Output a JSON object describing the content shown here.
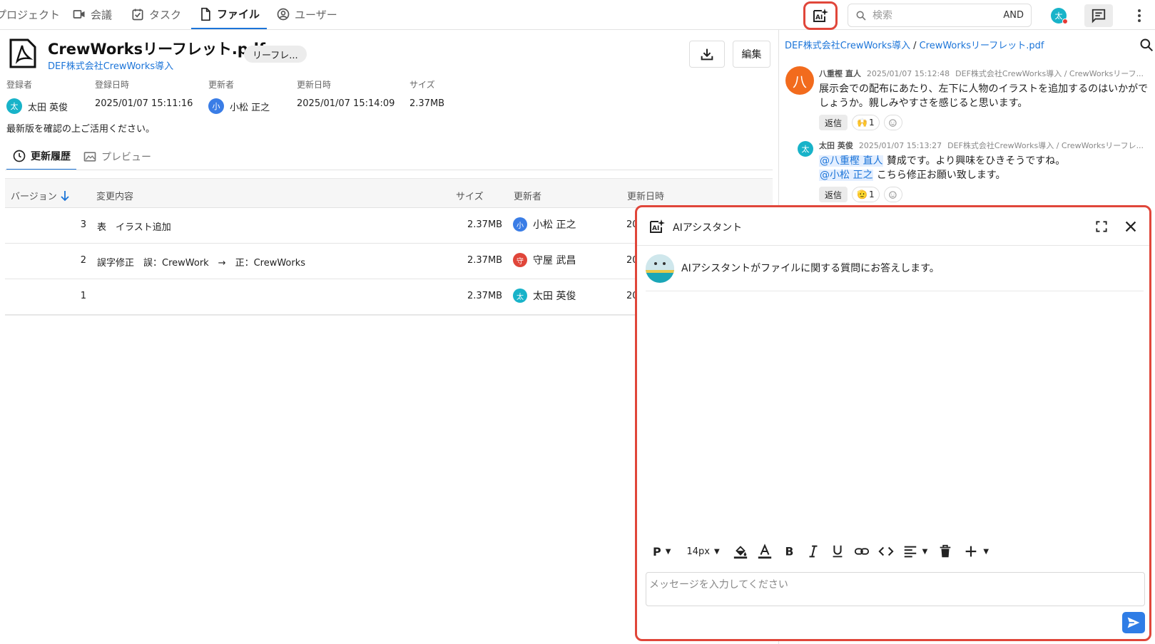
{
  "nav": {
    "tabs": [
      {
        "label": "プロジェクト",
        "icon": "project-icon"
      },
      {
        "label": "会議",
        "icon": "video-icon"
      },
      {
        "label": "タスク",
        "icon": "task-icon"
      },
      {
        "label": "ファイル",
        "icon": "file-icon",
        "active": true
      },
      {
        "label": "ユーザー",
        "icon": "user-circle-icon"
      }
    ],
    "search_placeholder": "検索",
    "search_mode": "AND",
    "user_initial": "太"
  },
  "file": {
    "title": "CrewWorksリーフレット.pdf",
    "tag": "リーフレ...",
    "project": "DEF株式会社CrewWorks導入",
    "edit_label": "編集",
    "meta": {
      "registrant_label": "登録者",
      "registrant": "太田 英俊",
      "registrant_initial": "太",
      "registered_at_label": "登録日時",
      "registered_at": "2025/01/07 15:11:16",
      "updater_label": "更新者",
      "updater": "小松 正之",
      "updater_initial": "小",
      "updated_at_label": "更新日時",
      "updated_at": "2025/01/07 15:14:09",
      "size_label": "サイズ",
      "size": "2.37MB"
    },
    "description": "最新版を確認の上ご活用ください。"
  },
  "subtabs": {
    "history": "更新履歴",
    "preview": "プレビュー"
  },
  "history_table": {
    "headers": {
      "version": "バージョン",
      "change": "変更内容",
      "size": "サイズ",
      "updater": "更新者",
      "updated_at": "更新日時"
    },
    "rows": [
      {
        "version": "3",
        "change": "表　イラスト追加",
        "size": "2.37MB",
        "updater": "小松 正之",
        "initial": "小",
        "color": "blue",
        "date": "20"
      },
      {
        "version": "2",
        "change": "誤字修正　誤：CrewWork　→　正：CrewWorks",
        "size": "2.37MB",
        "updater": "守屋 武昌",
        "initial": "守",
        "color": "red",
        "date": "20"
      },
      {
        "version": "1",
        "change": "",
        "size": "2.37MB",
        "updater": "太田 英俊",
        "initial": "太",
        "color": "teal",
        "date": "20"
      }
    ]
  },
  "comments": {
    "breadcrumb_project": "DEF株式会社CrewWorks導入",
    "breadcrumb_sep": "/",
    "breadcrumb_file": "CrewWorksリーフレット.pdf",
    "items": [
      {
        "author": "八重樫 直人",
        "initial": "八",
        "time": "2025/01/07 15:12:48",
        "context": "DEF株式会社CrewWorks導入 / CrewWorksリーフ...",
        "body": "展示会での配布にあたり、左下に人物のイラストを追加するのはいかがでしょうか。親しみやすさを感じると思います。",
        "reply_label": "返信",
        "reaction_emoji": "🙌",
        "reaction_count": "1"
      },
      {
        "author": "太田 英俊",
        "initial": "太",
        "time": "2025/01/07 15:13:27",
        "context": "DEF株式会社CrewWorks導入 / CrewWorksリーフレ...",
        "mention1": "@八重樫 直人",
        "body1": " 賛成です。より興味をひきそうですね。",
        "mention2": "@小松 正之",
        "body2": " こちら修正お願い致します。",
        "reply_label": "返信",
        "reaction_emoji": "🫡",
        "reaction_count": "1"
      }
    ]
  },
  "ai_panel": {
    "title": "AIアシスタント",
    "greeting": "AIアシスタントがファイルに関する質問にお答えします。",
    "toolbar": {
      "paragraph": "P",
      "font_size": "14px"
    },
    "input_placeholder": "メッセージを入力してください"
  },
  "colors": {
    "accent": "#1b74d8",
    "highlight_border": "#e0463a",
    "send": "#2f7de6"
  }
}
